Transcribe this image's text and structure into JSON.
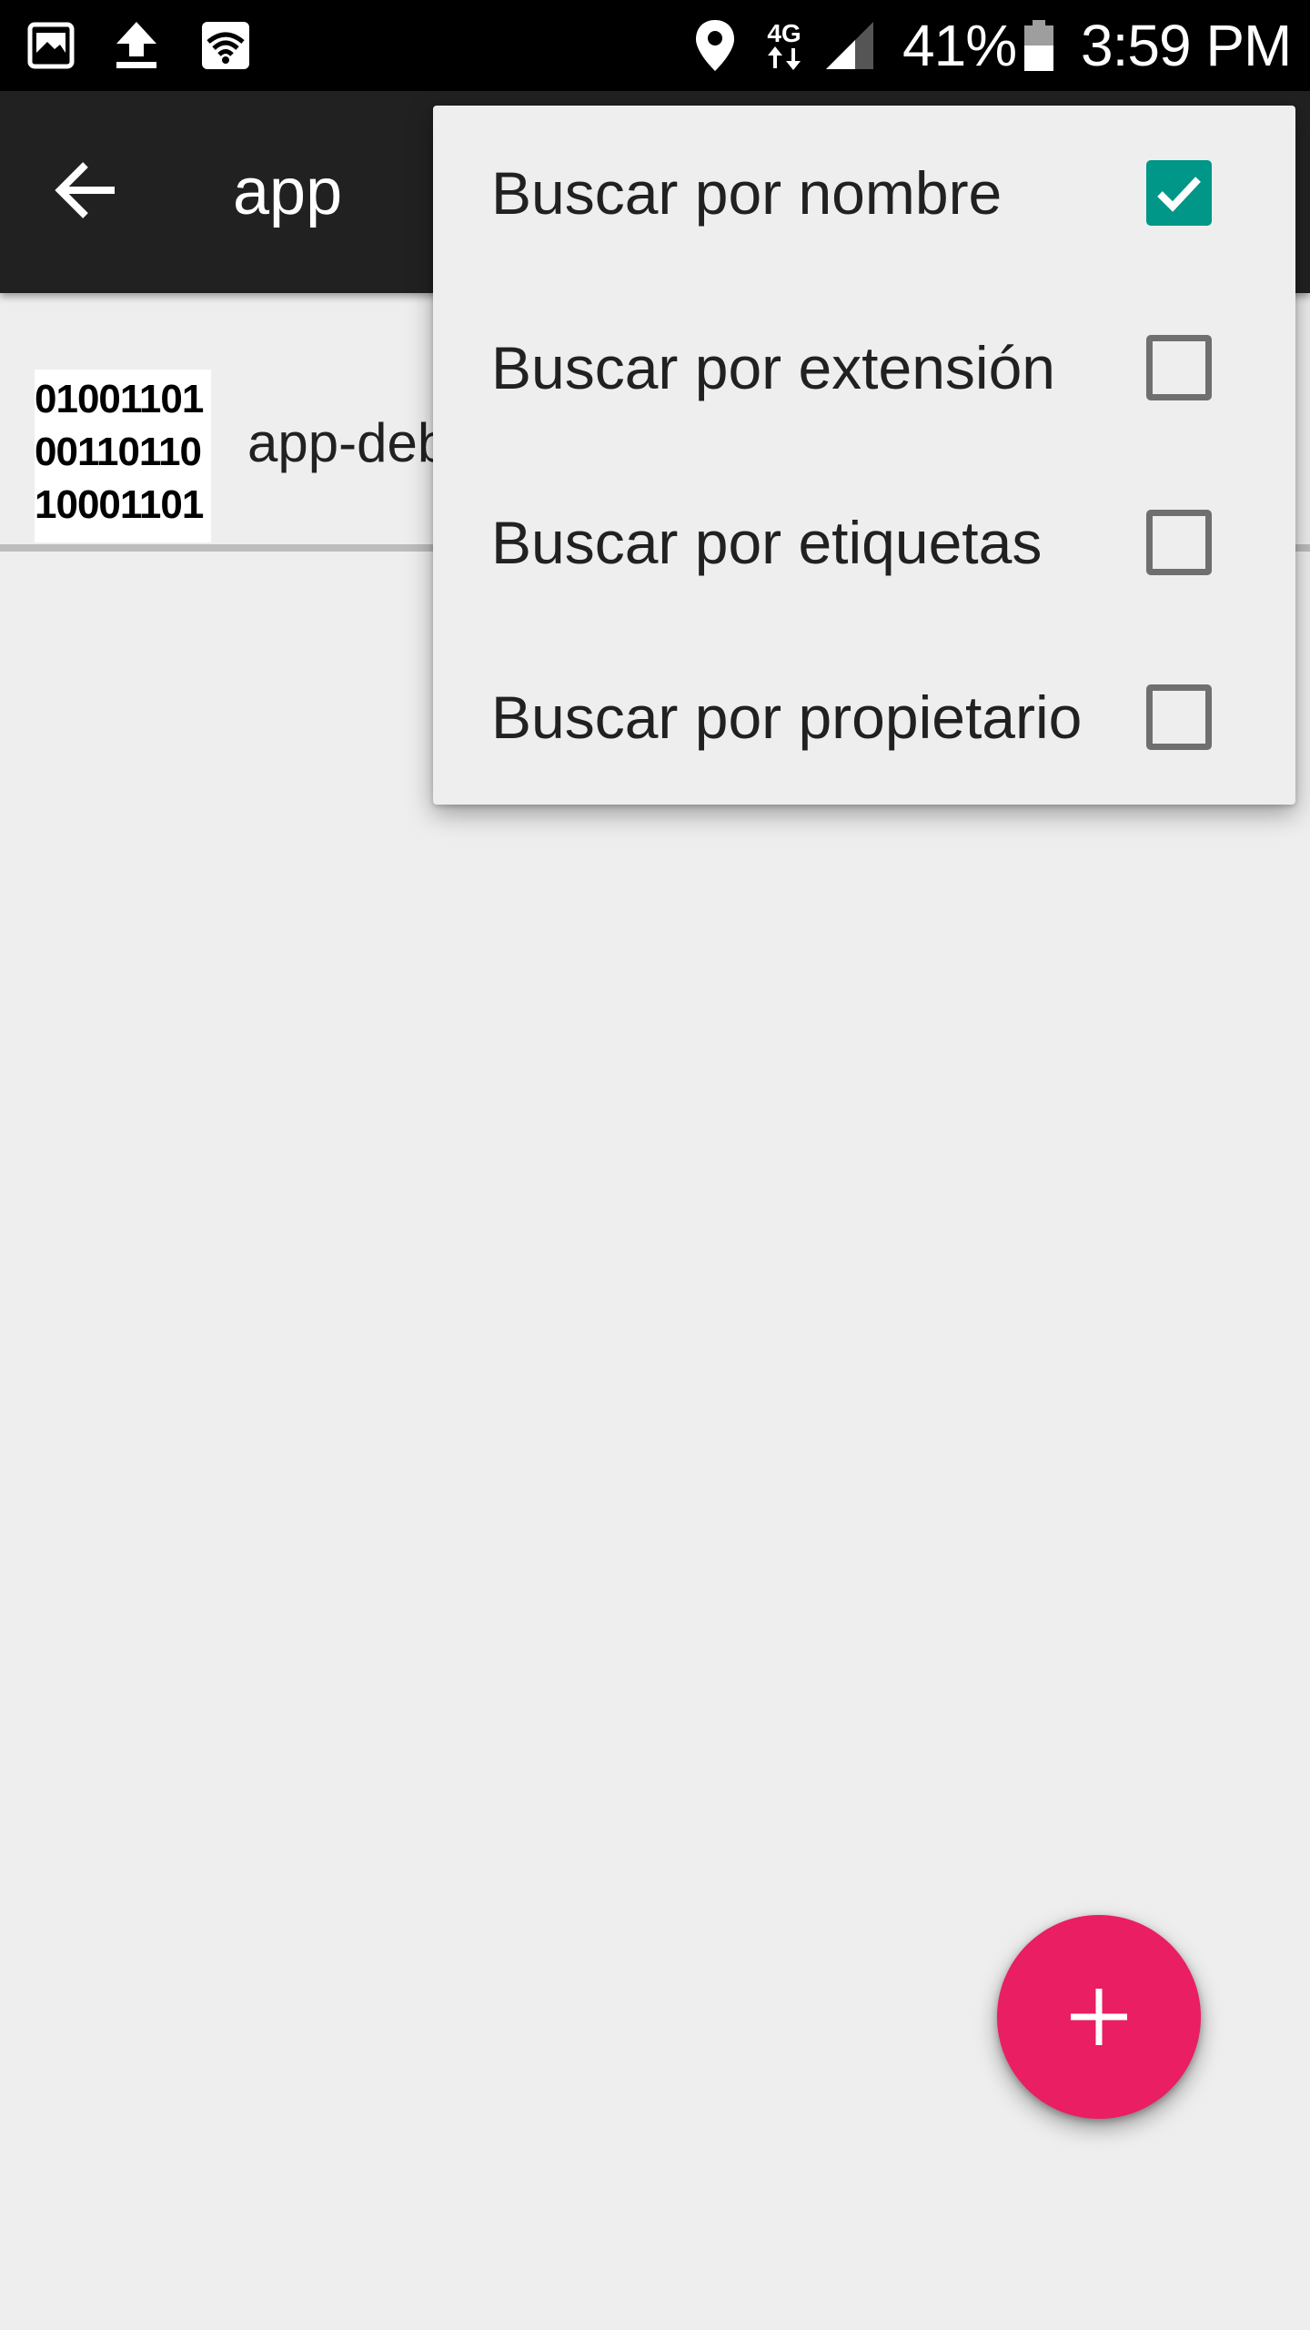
{
  "status_bar": {
    "battery_percent": "41%",
    "time": "3:59 PM",
    "network_label": "4G",
    "icons": [
      "gallery-icon",
      "upload-icon",
      "wifi-icon",
      "location-icon",
      "network-4g-icon",
      "signal-icon",
      "battery-icon"
    ]
  },
  "app_bar": {
    "title": "app",
    "back_icon": "arrow-left-icon"
  },
  "file_list": [
    {
      "name": "app-deb",
      "thumbnail_lines": [
        "01001101",
        "00110110",
        "10001101"
      ]
    }
  ],
  "menu": {
    "items": [
      {
        "label": "Buscar por nombre",
        "checked": true
      },
      {
        "label": "Buscar por extensión",
        "checked": false
      },
      {
        "label": "Buscar por etiquetas",
        "checked": false
      },
      {
        "label": "Buscar por propietario",
        "checked": false
      }
    ]
  },
  "fab": {
    "icon": "plus-icon"
  },
  "colors": {
    "status_bar": "#000000",
    "app_bar": "#212121",
    "background": "#eeeeee",
    "checkbox_checked": "#009688",
    "fab": "#e91e63"
  }
}
